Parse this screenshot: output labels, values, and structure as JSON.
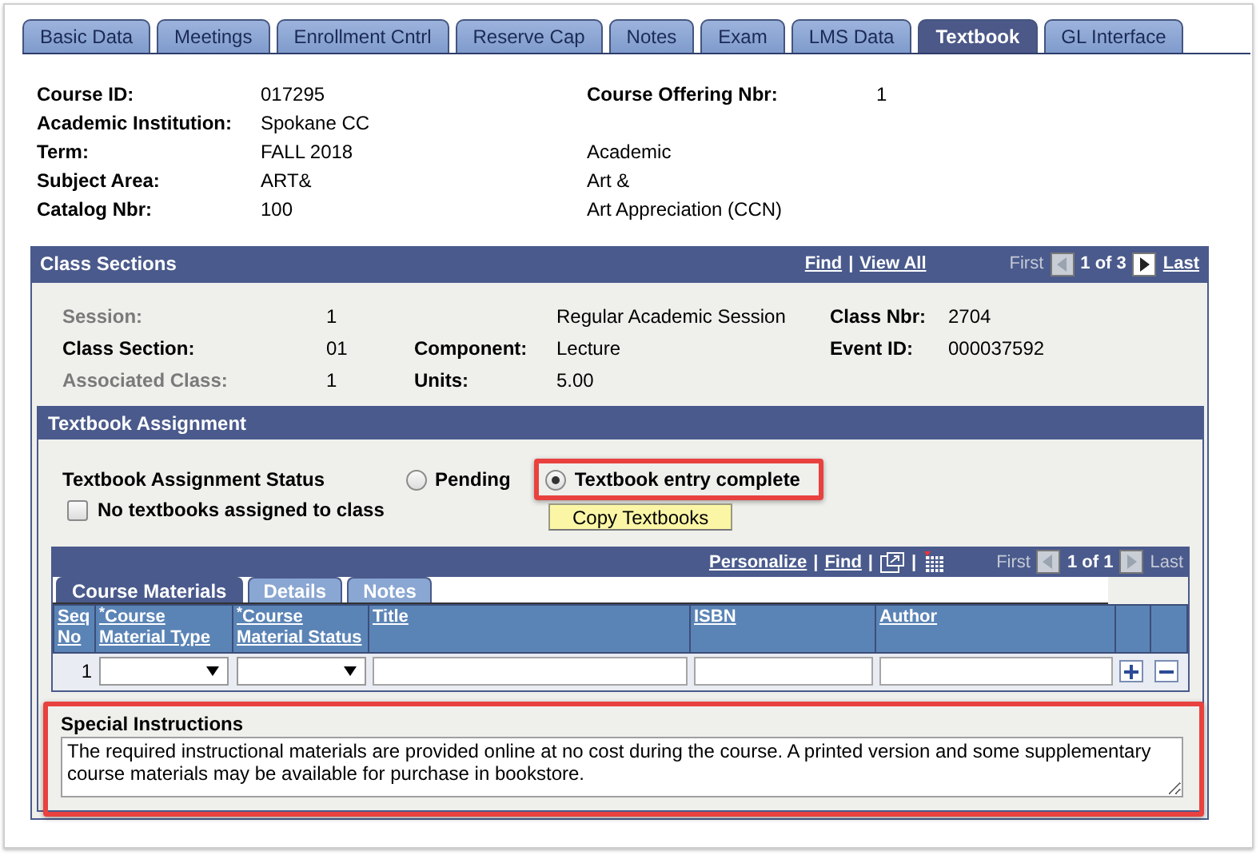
{
  "tabs": [
    {
      "label": "Basic Data",
      "selected": false
    },
    {
      "label": "Meetings",
      "selected": false
    },
    {
      "label": "Enrollment Cntrl",
      "selected": false
    },
    {
      "label": "Reserve Cap",
      "selected": false
    },
    {
      "label": "Notes",
      "selected": false
    },
    {
      "label": "Exam",
      "selected": false
    },
    {
      "label": "LMS Data",
      "selected": false
    },
    {
      "label": "Textbook",
      "selected": true
    },
    {
      "label": "GL Interface",
      "selected": false
    }
  ],
  "course_fields": [
    {
      "label": "Course ID:",
      "value": "017295",
      "extra_label": "Course Offering Nbr:",
      "extra_value": "1"
    },
    {
      "label": "Academic Institution:",
      "value": "Spokane CC"
    },
    {
      "label": "Term:",
      "value": "FALL 2018",
      "description": "Academic"
    },
    {
      "label": "Subject Area:",
      "value": "ART&",
      "description": "Art &"
    },
    {
      "label": "Catalog Nbr:",
      "value": "100",
      "description": "Art Appreciation (CCN)"
    }
  ],
  "class_sections": {
    "title": "Class Sections",
    "links": [
      "Find",
      "View All"
    ],
    "separator": "|",
    "first": "First",
    "position": "1 of 3",
    "last": "Last",
    "rows": [
      {
        "items": [
          {
            "label": "Session:",
            "value": "1",
            "disabled": true
          },
          {
            "value": "Regular Academic Session"
          },
          {
            "label": "Class Nbr:",
            "value": "2704"
          }
        ]
      },
      {
        "items": [
          {
            "label": "Class Section:",
            "value": "01",
            "disabled": false
          },
          {
            "label": "Component:",
            "value": "Lecture"
          },
          {
            "label": "Event ID:",
            "value": "000037592"
          }
        ]
      },
      {
        "items": [
          {
            "label": "Associated Class:",
            "value": "1",
            "disabled": true
          },
          {
            "label": "Units:",
            "value": "5.00"
          }
        ]
      }
    ]
  },
  "textbook_assignment": {
    "title": "Textbook Assignment",
    "status_label": "Textbook Assignment Status",
    "radios": [
      {
        "label": "Pending",
        "selected": false,
        "highlighted": false
      },
      {
        "label": "Textbook entry complete",
        "selected": true,
        "highlighted": true
      }
    ],
    "checkbox": {
      "label": "No textbooks assigned to class",
      "checked": false
    },
    "copy_button": "Copy Textbooks",
    "grid": {
      "links": [
        "Personalize",
        "Find"
      ],
      "separators": [
        "|",
        "|",
        "|"
      ],
      "first": "First",
      "position": "1 of 1",
      "last": "Last",
      "tabs": [
        {
          "label": "Course Materials",
          "selected": true
        },
        {
          "label": "Details",
          "selected": false
        },
        {
          "label": "Notes",
          "selected": false
        }
      ],
      "columns": [
        {
          "label": "Seq No",
          "kind": "text"
        },
        {
          "label": "$^{*}$Course Material Type",
          "kind": "select"
        },
        {
          "label": "$^{*}$Course Material Status",
          "kind": "select"
        },
        {
          "label": "Title",
          "kind": "input"
        },
        {
          "label": "ISBN",
          "kind": "input"
        },
        {
          "label": "Author",
          "kind": "input"
        }
      ],
      "rows": [
        {
          "seq": "1"
        }
      ]
    },
    "special_instructions": {
      "label": "Special Instructions",
      "value": "The required instructional materials are provided online at no cost during the course. A printed version and some supplementary course materials may be available for purchase in bookstore.",
      "highlighted": true
    }
  }
}
